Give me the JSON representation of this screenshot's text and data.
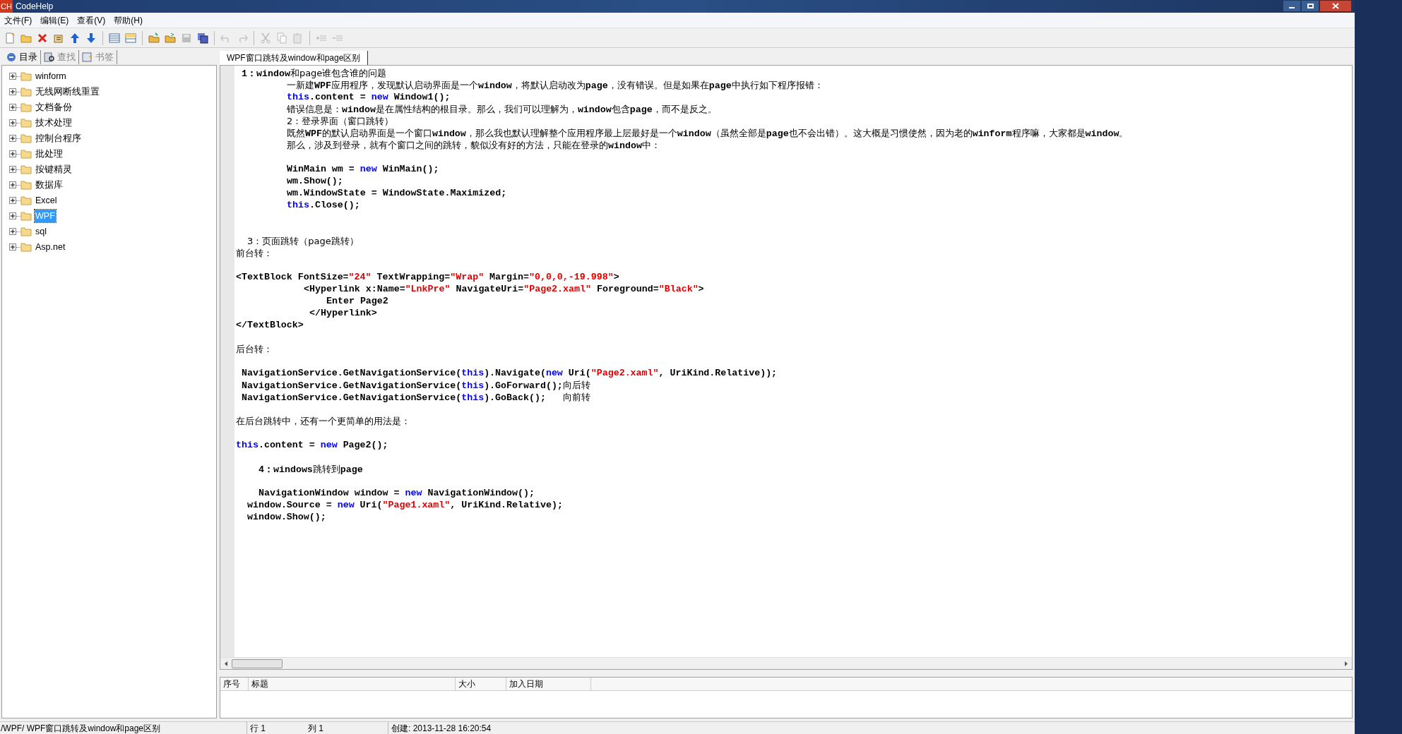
{
  "window": {
    "title": "CodeHelp",
    "logo": "CH"
  },
  "menu": [
    "文件(F)",
    "编辑(E)",
    "查看(V)",
    "帮助(H)"
  ],
  "toolbar": [
    {
      "kind": "newfile",
      "disabled": false
    },
    {
      "kind": "openfolder",
      "disabled": false
    },
    {
      "kind": "delete",
      "disabled": false
    },
    {
      "kind": "properties",
      "disabled": false
    },
    {
      "kind": "up",
      "disabled": false
    },
    {
      "kind": "down",
      "disabled": false
    },
    {
      "kind": "sep"
    },
    {
      "kind": "listview",
      "disabled": false
    },
    {
      "kind": "splitview",
      "disabled": false
    },
    {
      "kind": "sep"
    },
    {
      "kind": "folderopen",
      "disabled": false
    },
    {
      "kind": "folderexport",
      "disabled": false
    },
    {
      "kind": "save",
      "disabled": true
    },
    {
      "kind": "saveall",
      "disabled": false
    },
    {
      "kind": "sep"
    },
    {
      "kind": "undo",
      "disabled": true
    },
    {
      "kind": "redo",
      "disabled": true
    },
    {
      "kind": "sep"
    },
    {
      "kind": "cut",
      "disabled": true
    },
    {
      "kind": "copy",
      "disabled": true
    },
    {
      "kind": "paste",
      "disabled": true
    },
    {
      "kind": "sep"
    },
    {
      "kind": "indent",
      "disabled": true
    },
    {
      "kind": "outdent",
      "disabled": true
    }
  ],
  "side_tabs": [
    {
      "label": "目录",
      "selected": true,
      "kind": "catalog"
    },
    {
      "label": "查找",
      "selected": false,
      "kind": "find"
    },
    {
      "label": "书签",
      "selected": false,
      "kind": "bookmark"
    }
  ],
  "tree": [
    {
      "label": "winform",
      "expanded": false,
      "selected": false
    },
    {
      "label": "无线网断线重置",
      "expanded": false,
      "selected": false
    },
    {
      "label": "文档备份",
      "expanded": false,
      "selected": false
    },
    {
      "label": "技术处理",
      "expanded": false,
      "selected": false
    },
    {
      "label": "控制台程序",
      "expanded": false,
      "selected": false
    },
    {
      "label": "批处理",
      "expanded": false,
      "selected": false
    },
    {
      "label": "按键精灵",
      "expanded": false,
      "selected": false
    },
    {
      "label": "数据库",
      "expanded": false,
      "selected": false
    },
    {
      "label": "Excel",
      "expanded": false,
      "selected": false
    },
    {
      "label": "WPF",
      "expanded": false,
      "selected": true
    },
    {
      "label": "sql",
      "expanded": false,
      "selected": false
    },
    {
      "label": "Asp.net",
      "expanded": false,
      "selected": false
    }
  ],
  "doc_tabs": [
    {
      "label": "WPF窗口跳转及window和page区别",
      "selected": true
    }
  ],
  "editor_lines": [
    {
      "kind": "text",
      "segments": [
        {
          "kind": "code",
          "text": " 1："
        },
        {
          "kind": "code",
          "text": "window"
        },
        {
          "kind": "text",
          "text": "和page谁包含谁的问题"
        }
      ]
    },
    {
      "kind": "text",
      "segments": [
        {
          "kind": "text",
          "text": "         一新建"
        },
        {
          "kind": "code",
          "text": "WPF"
        },
        {
          "kind": "text",
          "text": "应用程序，发现默认启动界面是一个"
        },
        {
          "kind": "code",
          "text": "window"
        },
        {
          "kind": "text",
          "text": "，将默认启动改为"
        },
        {
          "kind": "code",
          "text": "page"
        },
        {
          "kind": "text",
          "text": "，没有错误。但是如果在"
        },
        {
          "kind": "code",
          "text": "page"
        },
        {
          "kind": "text",
          "text": "中执行如下程序报错："
        }
      ]
    },
    {
      "kind": "text",
      "segments": [
        {
          "kind": "keyword",
          "text": "         this"
        },
        {
          "kind": "code",
          "text": ".content = "
        },
        {
          "kind": "keyword",
          "text": "new"
        },
        {
          "kind": "code",
          "text": " Window1();"
        }
      ]
    },
    {
      "kind": "text",
      "segments": [
        {
          "kind": "text",
          "text": "         错误信息是："
        },
        {
          "kind": "code",
          "text": "window"
        },
        {
          "kind": "text",
          "text": "是在属性结构的根目录。那么，我们可以理解为，"
        },
        {
          "kind": "code",
          "text": "window"
        },
        {
          "kind": "text",
          "text": "包含"
        },
        {
          "kind": "code",
          "text": "page"
        },
        {
          "kind": "text",
          "text": "，而不是反之。"
        }
      ]
    },
    {
      "kind": "text",
      "segments": [
        {
          "kind": "text",
          "text": "         2：登录界面（窗口跳转）"
        }
      ]
    },
    {
      "kind": "text",
      "segments": [
        {
          "kind": "text",
          "text": "         既然"
        },
        {
          "kind": "code",
          "text": "WPF"
        },
        {
          "kind": "text",
          "text": "的默认启动界面是一个窗口"
        },
        {
          "kind": "code",
          "text": "window"
        },
        {
          "kind": "text",
          "text": "，那么我也默认理解整个应用程序最上层最好是一个"
        },
        {
          "kind": "code",
          "text": "window"
        },
        {
          "kind": "text",
          "text": "（虽然全部是"
        },
        {
          "kind": "code",
          "text": "page"
        },
        {
          "kind": "text",
          "text": "也不会出错）。这大概是习惯使然，因为老的"
        },
        {
          "kind": "code",
          "text": "winform"
        },
        {
          "kind": "text",
          "text": "程序嘛，大家都是"
        },
        {
          "kind": "code",
          "text": "window"
        },
        {
          "kind": "text",
          "text": "。"
        }
      ]
    },
    {
      "kind": "text",
      "segments": [
        {
          "kind": "text",
          "text": "         那么，涉及到登录，就有个窗口之间的跳转，貌似没有好的方法，只能在登录的"
        },
        {
          "kind": "code",
          "text": "window"
        },
        {
          "kind": "text",
          "text": "中："
        }
      ]
    },
    {
      "kind": "blank"
    },
    {
      "kind": "code",
      "segments": [
        {
          "kind": "code",
          "text": "         WinMain wm = "
        },
        {
          "kind": "keyword",
          "text": "new"
        },
        {
          "kind": "code",
          "text": " WinMain();"
        }
      ]
    },
    {
      "kind": "code",
      "segments": [
        {
          "kind": "code",
          "text": "         wm.Show();"
        }
      ]
    },
    {
      "kind": "code",
      "segments": [
        {
          "kind": "code",
          "text": "         wm.WindowState = WindowState.Maximized;"
        }
      ]
    },
    {
      "kind": "code",
      "segments": [
        {
          "kind": "keyword",
          "text": "         this"
        },
        {
          "kind": "code",
          "text": ".Close();"
        }
      ]
    },
    {
      "kind": "blank"
    },
    {
      "kind": "blank"
    },
    {
      "kind": "text",
      "segments": [
        {
          "kind": "text",
          "text": "  3：页面跳转（page跳转）"
        }
      ]
    },
    {
      "kind": "text",
      "segments": [
        {
          "kind": "text",
          "text": "前台转："
        }
      ]
    },
    {
      "kind": "blank"
    },
    {
      "kind": "code",
      "segments": [
        {
          "kind": "code",
          "text": "<TextBlock FontSize="
        },
        {
          "kind": "string",
          "text": "\"24\""
        },
        {
          "kind": "code",
          "text": " TextWrapping="
        },
        {
          "kind": "string",
          "text": "\"Wrap\""
        },
        {
          "kind": "code",
          "text": " Margin="
        },
        {
          "kind": "string",
          "text": "\"0,0,0,-19.998\""
        },
        {
          "kind": "code",
          "text": ">"
        }
      ]
    },
    {
      "kind": "code",
      "segments": [
        {
          "kind": "code",
          "text": "            <Hyperlink x:Name="
        },
        {
          "kind": "string",
          "text": "\"LnkPre\""
        },
        {
          "kind": "code",
          "text": " NavigateUri="
        },
        {
          "kind": "string",
          "text": "\"Page2.xaml\""
        },
        {
          "kind": "code",
          "text": " Foreground="
        },
        {
          "kind": "string",
          "text": "\"Black\""
        },
        {
          "kind": "code",
          "text": ">"
        }
      ]
    },
    {
      "kind": "code",
      "segments": [
        {
          "kind": "code",
          "text": "                Enter Page2"
        }
      ]
    },
    {
      "kind": "code",
      "segments": [
        {
          "kind": "code",
          "text": "             </Hyperlink>"
        }
      ]
    },
    {
      "kind": "code",
      "segments": [
        {
          "kind": "code",
          "text": "</TextBlock>"
        }
      ]
    },
    {
      "kind": "blank"
    },
    {
      "kind": "text",
      "segments": [
        {
          "kind": "text",
          "text": "后台转："
        }
      ]
    },
    {
      "kind": "blank"
    },
    {
      "kind": "code",
      "segments": [
        {
          "kind": "code",
          "text": " NavigationService.GetNavigationService("
        },
        {
          "kind": "keyword",
          "text": "this"
        },
        {
          "kind": "code",
          "text": ").Navigate("
        },
        {
          "kind": "keyword",
          "text": "new"
        },
        {
          "kind": "code",
          "text": " Uri("
        },
        {
          "kind": "string",
          "text": "\"Page2.xaml\""
        },
        {
          "kind": "code",
          "text": ", UriKind.Relative));"
        }
      ]
    },
    {
      "kind": "code",
      "segments": [
        {
          "kind": "code",
          "text": " NavigationService.GetNavigationService("
        },
        {
          "kind": "keyword",
          "text": "this"
        },
        {
          "kind": "code",
          "text": ").GoForward();"
        },
        {
          "kind": "text",
          "text": "向后转"
        }
      ]
    },
    {
      "kind": "code",
      "segments": [
        {
          "kind": "code",
          "text": " NavigationService.GetNavigationService("
        },
        {
          "kind": "keyword",
          "text": "this"
        },
        {
          "kind": "code",
          "text": ").GoBack();   "
        },
        {
          "kind": "text",
          "text": "向前转"
        }
      ]
    },
    {
      "kind": "blank"
    },
    {
      "kind": "text",
      "segments": [
        {
          "kind": "text",
          "text": "在后台跳转中，还有一个更简单的用法是："
        }
      ]
    },
    {
      "kind": "blank"
    },
    {
      "kind": "code",
      "segments": [
        {
          "kind": "keyword",
          "text": "this"
        },
        {
          "kind": "code",
          "text": ".content = "
        },
        {
          "kind": "keyword",
          "text": "new"
        },
        {
          "kind": "code",
          "text": " Page2();"
        }
      ]
    },
    {
      "kind": "blank"
    },
    {
      "kind": "text",
      "segments": [
        {
          "kind": "code",
          "text": "    4：windows"
        },
        {
          "kind": "text",
          "text": "跳转到"
        },
        {
          "kind": "code",
          "text": "page"
        }
      ]
    },
    {
      "kind": "blank"
    },
    {
      "kind": "code",
      "segments": [
        {
          "kind": "code",
          "text": "    NavigationWindow window = "
        },
        {
          "kind": "keyword",
          "text": "new"
        },
        {
          "kind": "code",
          "text": " NavigationWindow();"
        }
      ]
    },
    {
      "kind": "code",
      "segments": [
        {
          "kind": "code",
          "text": "  window.Source = "
        },
        {
          "kind": "keyword",
          "text": "new"
        },
        {
          "kind": "code",
          "text": " Uri("
        },
        {
          "kind": "string",
          "text": "\"Page1.xaml\""
        },
        {
          "kind": "code",
          "text": ", UriKind.Relative);"
        }
      ]
    },
    {
      "kind": "code",
      "segments": [
        {
          "kind": "code",
          "text": "  window.Show();"
        }
      ]
    }
  ],
  "list": {
    "columns": [
      "序号",
      "标题",
      "大小",
      "加入日期"
    ]
  },
  "status_bar": {
    "path": "/WPF/ WPF窗口跳转及window和page区别",
    "row": "行 1",
    "col": "列 1",
    "created": "创建: 2013-11-28 16:20:54"
  }
}
